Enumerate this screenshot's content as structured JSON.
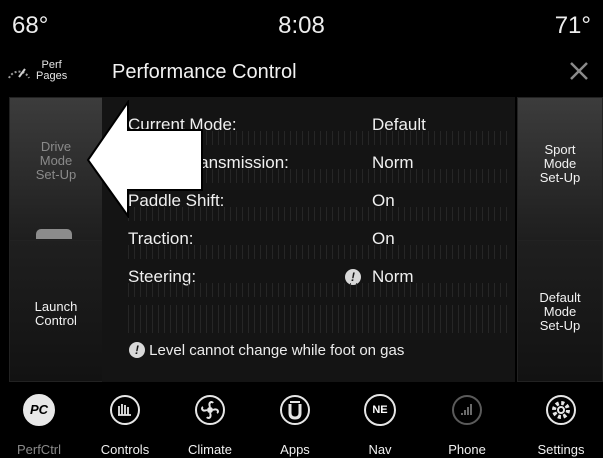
{
  "status": {
    "temp_left": "68°",
    "time": "8:08",
    "temp_right": "71°"
  },
  "header": {
    "perf_pages_label": "Perf\nPages",
    "title": "Performance Control",
    "close_icon": "close-x-icon"
  },
  "side_buttons": {
    "drive_mode_setup": "Drive\nMode\nSet-Up",
    "launch_control": "Launch\nControl",
    "sport_mode_setup": "Sport\nMode\nSet-Up",
    "default_mode_setup": "Default\nMode\nSet-Up"
  },
  "settings": [
    {
      "label": "Current Mode:",
      "value": "Default"
    },
    {
      "label": "/Transmission:",
      "value": "Norm"
    },
    {
      "label": "Paddle Shift:",
      "value": "On"
    },
    {
      "label": "Traction:",
      "value": "On"
    },
    {
      "label": "Steering:",
      "value": "Norm",
      "warning": true
    }
  ],
  "warning_icon_glyph": "!",
  "notice": "Level cannot change while foot on gas",
  "dock": [
    {
      "label": "PerfCtrl",
      "icon": "PC",
      "active": true
    },
    {
      "label": "Controls",
      "icon": "controls-icon"
    },
    {
      "label": "Climate",
      "icon": "climate-icon"
    },
    {
      "label": "Apps",
      "icon": "apps-icon"
    },
    {
      "label": "Nav",
      "icon": "NE"
    },
    {
      "label": "Phone",
      "icon": "phone-signal-icon"
    },
    {
      "label": "Settings",
      "icon": "gear-icon"
    }
  ]
}
